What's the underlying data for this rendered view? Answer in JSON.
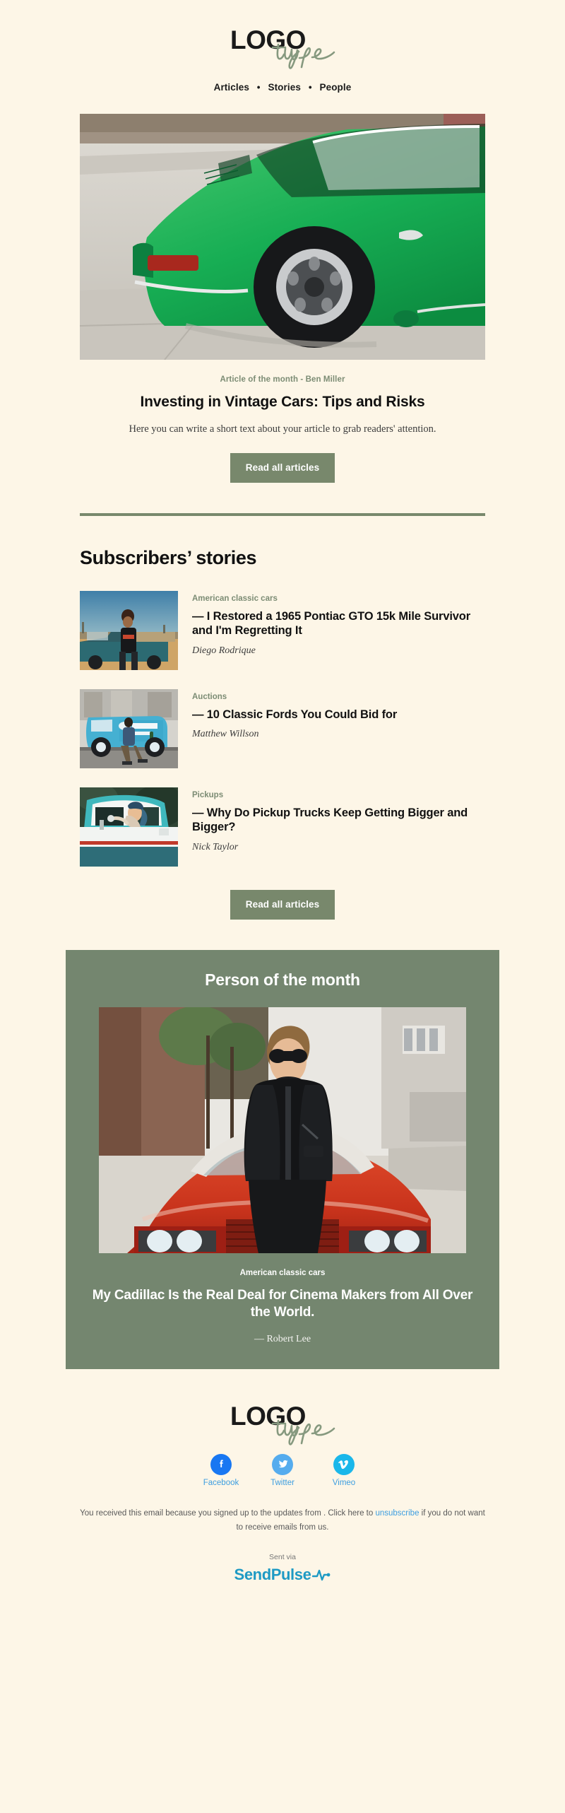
{
  "brand": {
    "logo_main": "LOGO",
    "logo_script": "type",
    "accent_green": "#78886c",
    "panel_green": "#74866f",
    "background": "#fdf6e7"
  },
  "nav": {
    "items": [
      {
        "label": "Articles"
      },
      {
        "label": "Stories"
      },
      {
        "label": "People"
      }
    ],
    "separator": "•"
  },
  "hero": {
    "alt": "Green vintage Porsche 911 parked on a concrete driveway"
  },
  "article": {
    "eyebrow": "Article of the month - Ben Miller",
    "title": "Investing in Vintage Cars: Tips and Risks",
    "description": "Here you can write a short text about your article to grab readers' attention.",
    "cta": "Read all articles"
  },
  "stories_section": {
    "heading": "Subscribers’ stories",
    "cta": "Read all articles",
    "items": [
      {
        "category": "American classic cars",
        "title": "— I Restored a 1965 Pontiac GTO 15k Mile Survivor and I'm Regretting It",
        "author": "Diego Rodrique",
        "alt": "Young man sitting on the bed of a teal pickup truck at sunset"
      },
      {
        "category": "Auctions",
        "title": "— 10 Classic Fords You Could Bid for",
        "author": "Matthew Willson",
        "alt": "Man walking past a light blue vintage VW food truck"
      },
      {
        "category": "Pickups",
        "title": "— Why Do Pickup Trucks Keep Getting Bigger and Bigger?",
        "author": "Nick Taylor",
        "alt": "Woman with a bandana leaning out of a teal vintage pickup truck"
      }
    ]
  },
  "person_section": {
    "heading": "Person of the month",
    "category": "American classic cars",
    "title": "My Cadillac Is the Real Deal for Cinema Makers from All Over the World.",
    "author": "— Robert Lee",
    "alt": "Man in black leather jacket and sunglasses standing in front of a red classic Cadillac"
  },
  "footer": {
    "socials": [
      {
        "name": "Facebook",
        "icon": "facebook-icon",
        "color": "#1877f2"
      },
      {
        "name": "Twitter",
        "icon": "twitter-icon",
        "color": "#55acee"
      },
      {
        "name": "Vimeo",
        "icon": "vimeo-icon",
        "color": "#1ab7ea"
      }
    ],
    "legal_before": "You received this email because you signed up to the updates from . Click here to ",
    "legal_link": "unsubscribe",
    "legal_after": " if you do not want to receive emails from us.",
    "sent_via": "Sent via",
    "provider": "SendPulse"
  }
}
